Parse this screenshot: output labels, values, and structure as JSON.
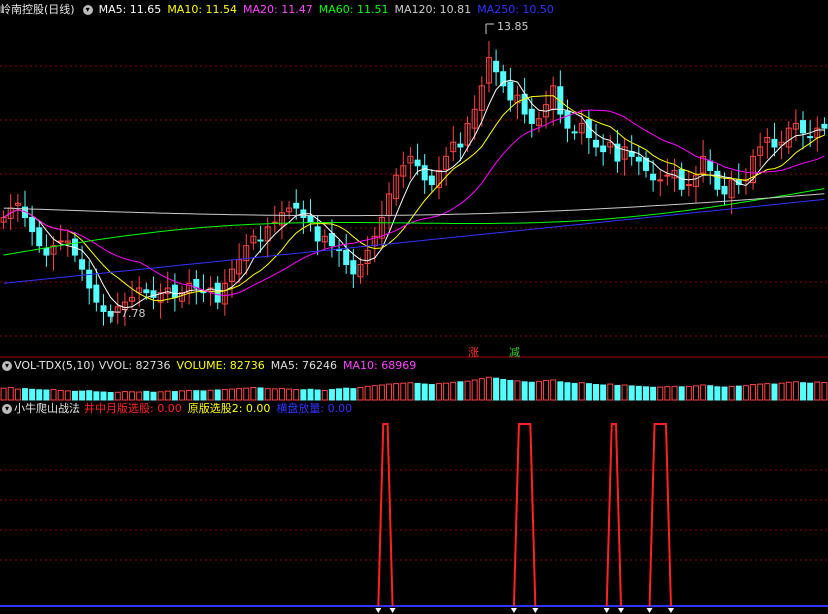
{
  "colors": {
    "up": "#ff4444",
    "down": "#54ffff",
    "ma5": "#ffffff",
    "ma10": "#ffff00",
    "ma20": "#ff00ff",
    "ma60": "#00ff00",
    "ma120": "#cccccc",
    "ma250": "#3333ff",
    "grid": "#8b0000"
  },
  "panel_price": {
    "stock": "岭南控股(日线)",
    "ma_labels": [
      {
        "text": "MA5: 11.65",
        "color": "#ffffff"
      },
      {
        "text": "MA10: 11.54",
        "color": "#ffff00"
      },
      {
        "text": "MA20: 11.47",
        "color": "#ff44ff"
      },
      {
        "text": "MA60: 11.51",
        "color": "#00ff00"
      },
      {
        "text": "MA120: 10.81",
        "color": "#cccccc"
      },
      {
        "text": "MA250: 10.50",
        "color": "#3333ff"
      }
    ],
    "high_label": "13.85",
    "low_label": "7.78",
    "tag_up": "涨",
    "tag_down": "减"
  },
  "panel_volume": {
    "label": "VOL-TDX(5,10)",
    "items": [
      {
        "text": "VVOL: 82736",
        "color": "#dddddd"
      },
      {
        "text": "VOLUME: 82736",
        "color": "#ffff00"
      },
      {
        "text": "MA5: 76246",
        "color": "#dddddd"
      },
      {
        "text": "MA10: 68969",
        "color": "#ff44ff"
      }
    ]
  },
  "panel_indicator": {
    "label": "小牛爬山战法",
    "items": [
      {
        "text": "井中月版选股: 0.00",
        "color": "#ff2222"
      },
      {
        "text": "原版选股2: 0.00",
        "color": "#ffff00"
      },
      {
        "text": "横盘放量: 0.00",
        "color": "#3333ff"
      }
    ]
  },
  "chart_data": {
    "type": "candlestick",
    "count": 116,
    "high_point": 13.85,
    "low_point": 7.78,
    "close_series": [
      10.0,
      10.2,
      10.3,
      10.0,
      9.7,
      9.4,
      9.2,
      9.4,
      9.5,
      9.5,
      9.2,
      8.9,
      8.5,
      8.2,
      8.0,
      7.9,
      8.1,
      8.2,
      8.3,
      8.5,
      8.4,
      8.3,
      8.4,
      8.5,
      8.3,
      8.4,
      8.6,
      8.5,
      8.4,
      8.5,
      8.2,
      8.6,
      8.9,
      9.1,
      9.4,
      9.6,
      9.5,
      9.8,
      9.9,
      10.1,
      10.2,
      10.2,
      10.0,
      9.9,
      9.5,
      9.6,
      9.4,
      9.3,
      9.0,
      8.8,
      9.0,
      9.3,
      9.6,
      10.0,
      10.5,
      10.9,
      11.1,
      11.3,
      11.1,
      10.8,
      10.7,
      11.0,
      11.3,
      11.6,
      11.5,
      12.0,
      12.3,
      12.8,
      13.4,
      13.1,
      12.8,
      12.5,
      12.6,
      12.2,
      12.0,
      12.1,
      12.4,
      12.8,
      12.2,
      11.9,
      11.8,
      12.0,
      11.7,
      11.5,
      11.4,
      11.6,
      11.2,
      11.5,
      11.3,
      11.2,
      11.0,
      10.8,
      10.8,
      10.9,
      11.0,
      10.6,
      10.7,
      10.9,
      11.3,
      11.0,
      10.6,
      10.5,
      10.8,
      10.7,
      10.8,
      11.3,
      11.5,
      11.7,
      11.5,
      11.6,
      11.9,
      12.0,
      11.8,
      11.7,
      11.9,
      11.9
    ],
    "volume_series": [
      52,
      55,
      48,
      50,
      47,
      45,
      44,
      46,
      42,
      40,
      38,
      39,
      41,
      36,
      35,
      33,
      34,
      37,
      36,
      35,
      38,
      34,
      36,
      39,
      37,
      40,
      42,
      41,
      40,
      43,
      44,
      46,
      48,
      50,
      52,
      55,
      53,
      50,
      49,
      51,
      48,
      46,
      45,
      47,
      44,
      42,
      46,
      49,
      52,
      50,
      55,
      60,
      63,
      66,
      70,
      72,
      74,
      76,
      73,
      70,
      68,
      72,
      74,
      78,
      80,
      83,
      88,
      94,
      100,
      96,
      90,
      86,
      84,
      80,
      78,
      82,
      86,
      88,
      80,
      76,
      73,
      76,
      72,
      68,
      66,
      70,
      64,
      66,
      62,
      60,
      58,
      56,
      57,
      59,
      60,
      58,
      60,
      62,
      66,
      63,
      58,
      57,
      60,
      61,
      63,
      68,
      70,
      72,
      70,
      74,
      78,
      80,
      76,
      74,
      79,
      77
    ],
    "signal_pulses": [
      {
        "series": "井中月版选股",
        "start": 53,
        "end": 55
      },
      {
        "series": "井中月版选股",
        "start": 72,
        "end": 75
      },
      {
        "series": "井中月版选股",
        "start": 85,
        "end": 87
      },
      {
        "series": "井中月版选股",
        "start": 91,
        "end": 94
      }
    ]
  }
}
